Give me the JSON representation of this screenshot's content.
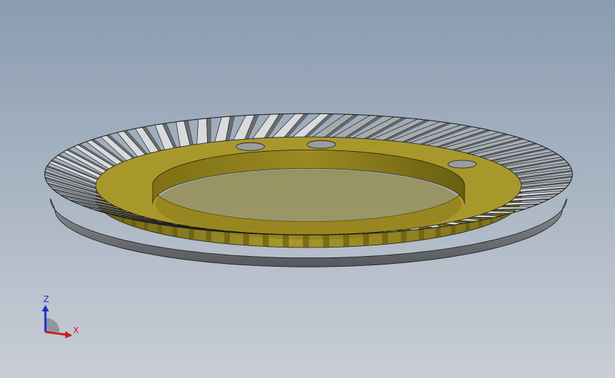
{
  "viewport": {
    "background_top": "#8a9cb0",
    "background_bottom": "#c9ced6"
  },
  "model": {
    "part": "spiral-bevel-ring-gear",
    "tooth_count": 66,
    "bolt_hole_count": 3,
    "colors": {
      "body": "#8a7a18",
      "body_light": "#a8982c",
      "body_dark": "#5e5410",
      "tooth_light": "#d8dadc",
      "tooth_mid": "#a8abae",
      "tooth_dark": "#5f6367",
      "base": "#7f8388",
      "base_dark": "#55585c",
      "edge": "#1a1a1a",
      "hole": "#9a9ca0"
    }
  },
  "triad": {
    "z_label": "Z",
    "x_label": "X",
    "z_color": "#1f2fc8",
    "x_color": "#c81f1f",
    "origin_color": "#8a8d92"
  }
}
